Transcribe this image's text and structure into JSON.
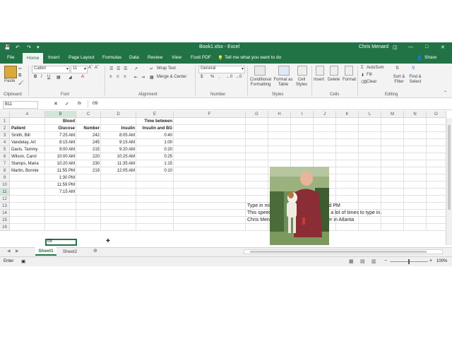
{
  "titlebar": {
    "filename": "Book1.xlsx - Excel",
    "user": "Chris Menard",
    "minimize": "—",
    "restore": "□",
    "close": "✕"
  },
  "tabs": [
    "File",
    "Home",
    "Insert",
    "Page Layout",
    "Formulas",
    "Data",
    "Review",
    "View",
    "Foxit PDF"
  ],
  "tell_me": "Tell me what you want to do",
  "share": "Share",
  "ribbon": {
    "clipboard": {
      "paste": "Paste",
      "label": "Clipboard"
    },
    "font": {
      "name": "Calibri",
      "size": "11",
      "label": "Font"
    },
    "alignment": {
      "wrap": "Wrap Text",
      "merge": "Merge & Center",
      "label": "Alignment"
    },
    "number": {
      "format": "General",
      "label": "Number"
    },
    "styles": {
      "cond": "Conditional Formatting",
      "table": "Format as Table",
      "cell": "Cell Styles",
      "label": "Styles"
    },
    "cells": {
      "insert": "Insert",
      "delete": "Delete",
      "format": "Format",
      "label": "Cells"
    },
    "editing": {
      "autosum": "AutoSum",
      "fill": "Fill",
      "clear": "Clear",
      "sort": "Sort & Filter",
      "find": "Find & Select",
      "label": "Editing"
    }
  },
  "formula_bar": {
    "name_box": "B11",
    "fx": "fx",
    "content": "09"
  },
  "columns": [
    "A",
    "B",
    "C",
    "D",
    "E",
    "F",
    "G",
    "H",
    "I",
    "J",
    "K",
    "L",
    "M",
    "N",
    "O"
  ],
  "rows": [
    "1",
    "2",
    "3",
    "4",
    "5",
    "6",
    "7",
    "8",
    "9",
    "10",
    "11",
    "12",
    "13",
    "14",
    "15",
    "16"
  ],
  "headers": {
    "A": "Patient",
    "B1": "Blood",
    "B2": "Glucose",
    "C": "Number",
    "D": "Insulin",
    "E1": "Time between",
    "E2": "Insulin and BG"
  },
  "table": [
    [
      "Smith, Bill",
      "7:25 AM",
      "242",
      "8:05 AM",
      "0:40"
    ],
    [
      "Vandelay, Art",
      "8:15 AM",
      "245",
      "9:15 AM",
      "1:00"
    ],
    [
      "Davis, Tammy",
      "9:00 AM",
      "215",
      "9:20 AM",
      "0:20"
    ],
    [
      "Wilson, Carol",
      "10:00 AM",
      "220",
      "10:25 AM",
      "0:25"
    ],
    [
      "Stamps, Maria",
      "10:20 AM",
      "230",
      "11:35 AM",
      "1:15"
    ],
    [
      "Martin, Bonnie",
      "11:55 PM",
      "219",
      "12:05 AM",
      "0:10"
    ]
  ],
  "extra_b": [
    "1:30 PM",
    "11:59 PM",
    "7:15 AM"
  ],
  "editing_cell": "09",
  "notes": [
    "Type in military time and show AM and PM",
    "This speeds up data entry if you have a lot of times to type in.",
    "Chris Menard - Microsoft Office Trainer in Atlanta"
  ],
  "sheets": [
    "Sheet1",
    "Sheet2"
  ],
  "status": {
    "mode": "Enter",
    "zoom": "100%"
  },
  "colors": {
    "excel_green": "#217346"
  }
}
